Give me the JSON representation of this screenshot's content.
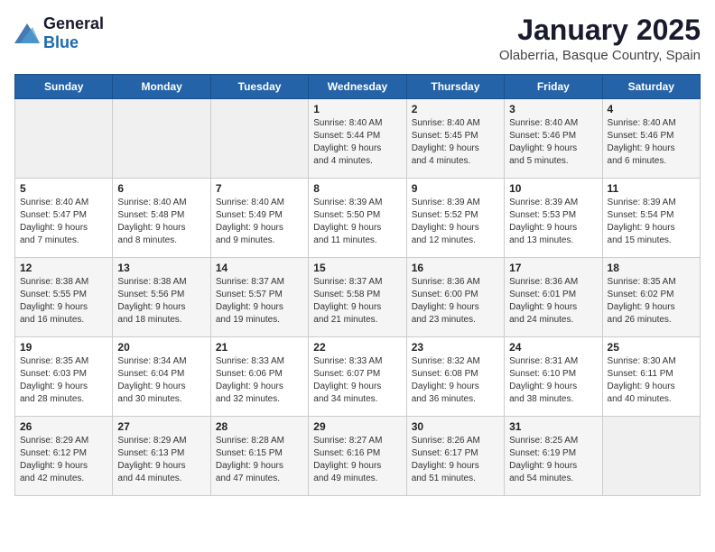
{
  "logo": {
    "general": "General",
    "blue": "Blue"
  },
  "title": "January 2025",
  "subtitle": "Olaberria, Basque Country, Spain",
  "weekdays": [
    "Sunday",
    "Monday",
    "Tuesday",
    "Wednesday",
    "Thursday",
    "Friday",
    "Saturday"
  ],
  "weeks": [
    [
      {
        "day": "",
        "info": ""
      },
      {
        "day": "",
        "info": ""
      },
      {
        "day": "",
        "info": ""
      },
      {
        "day": "1",
        "info": "Sunrise: 8:40 AM\nSunset: 5:44 PM\nDaylight: 9 hours\nand 4 minutes."
      },
      {
        "day": "2",
        "info": "Sunrise: 8:40 AM\nSunset: 5:45 PM\nDaylight: 9 hours\nand 4 minutes."
      },
      {
        "day": "3",
        "info": "Sunrise: 8:40 AM\nSunset: 5:46 PM\nDaylight: 9 hours\nand 5 minutes."
      },
      {
        "day": "4",
        "info": "Sunrise: 8:40 AM\nSunset: 5:46 PM\nDaylight: 9 hours\nand 6 minutes."
      }
    ],
    [
      {
        "day": "5",
        "info": "Sunrise: 8:40 AM\nSunset: 5:47 PM\nDaylight: 9 hours\nand 7 minutes."
      },
      {
        "day": "6",
        "info": "Sunrise: 8:40 AM\nSunset: 5:48 PM\nDaylight: 9 hours\nand 8 minutes."
      },
      {
        "day": "7",
        "info": "Sunrise: 8:40 AM\nSunset: 5:49 PM\nDaylight: 9 hours\nand 9 minutes."
      },
      {
        "day": "8",
        "info": "Sunrise: 8:39 AM\nSunset: 5:50 PM\nDaylight: 9 hours\nand 11 minutes."
      },
      {
        "day": "9",
        "info": "Sunrise: 8:39 AM\nSunset: 5:52 PM\nDaylight: 9 hours\nand 12 minutes."
      },
      {
        "day": "10",
        "info": "Sunrise: 8:39 AM\nSunset: 5:53 PM\nDaylight: 9 hours\nand 13 minutes."
      },
      {
        "day": "11",
        "info": "Sunrise: 8:39 AM\nSunset: 5:54 PM\nDaylight: 9 hours\nand 15 minutes."
      }
    ],
    [
      {
        "day": "12",
        "info": "Sunrise: 8:38 AM\nSunset: 5:55 PM\nDaylight: 9 hours\nand 16 minutes."
      },
      {
        "day": "13",
        "info": "Sunrise: 8:38 AM\nSunset: 5:56 PM\nDaylight: 9 hours\nand 18 minutes."
      },
      {
        "day": "14",
        "info": "Sunrise: 8:37 AM\nSunset: 5:57 PM\nDaylight: 9 hours\nand 19 minutes."
      },
      {
        "day": "15",
        "info": "Sunrise: 8:37 AM\nSunset: 5:58 PM\nDaylight: 9 hours\nand 21 minutes."
      },
      {
        "day": "16",
        "info": "Sunrise: 8:36 AM\nSunset: 6:00 PM\nDaylight: 9 hours\nand 23 minutes."
      },
      {
        "day": "17",
        "info": "Sunrise: 8:36 AM\nSunset: 6:01 PM\nDaylight: 9 hours\nand 24 minutes."
      },
      {
        "day": "18",
        "info": "Sunrise: 8:35 AM\nSunset: 6:02 PM\nDaylight: 9 hours\nand 26 minutes."
      }
    ],
    [
      {
        "day": "19",
        "info": "Sunrise: 8:35 AM\nSunset: 6:03 PM\nDaylight: 9 hours\nand 28 minutes."
      },
      {
        "day": "20",
        "info": "Sunrise: 8:34 AM\nSunset: 6:04 PM\nDaylight: 9 hours\nand 30 minutes."
      },
      {
        "day": "21",
        "info": "Sunrise: 8:33 AM\nSunset: 6:06 PM\nDaylight: 9 hours\nand 32 minutes."
      },
      {
        "day": "22",
        "info": "Sunrise: 8:33 AM\nSunset: 6:07 PM\nDaylight: 9 hours\nand 34 minutes."
      },
      {
        "day": "23",
        "info": "Sunrise: 8:32 AM\nSunset: 6:08 PM\nDaylight: 9 hours\nand 36 minutes."
      },
      {
        "day": "24",
        "info": "Sunrise: 8:31 AM\nSunset: 6:10 PM\nDaylight: 9 hours\nand 38 minutes."
      },
      {
        "day": "25",
        "info": "Sunrise: 8:30 AM\nSunset: 6:11 PM\nDaylight: 9 hours\nand 40 minutes."
      }
    ],
    [
      {
        "day": "26",
        "info": "Sunrise: 8:29 AM\nSunset: 6:12 PM\nDaylight: 9 hours\nand 42 minutes."
      },
      {
        "day": "27",
        "info": "Sunrise: 8:29 AM\nSunset: 6:13 PM\nDaylight: 9 hours\nand 44 minutes."
      },
      {
        "day": "28",
        "info": "Sunrise: 8:28 AM\nSunset: 6:15 PM\nDaylight: 9 hours\nand 47 minutes."
      },
      {
        "day": "29",
        "info": "Sunrise: 8:27 AM\nSunset: 6:16 PM\nDaylight: 9 hours\nand 49 minutes."
      },
      {
        "day": "30",
        "info": "Sunrise: 8:26 AM\nSunset: 6:17 PM\nDaylight: 9 hours\nand 51 minutes."
      },
      {
        "day": "31",
        "info": "Sunrise: 8:25 AM\nSunset: 6:19 PM\nDaylight: 9 hours\nand 54 minutes."
      },
      {
        "day": "",
        "info": ""
      }
    ]
  ]
}
